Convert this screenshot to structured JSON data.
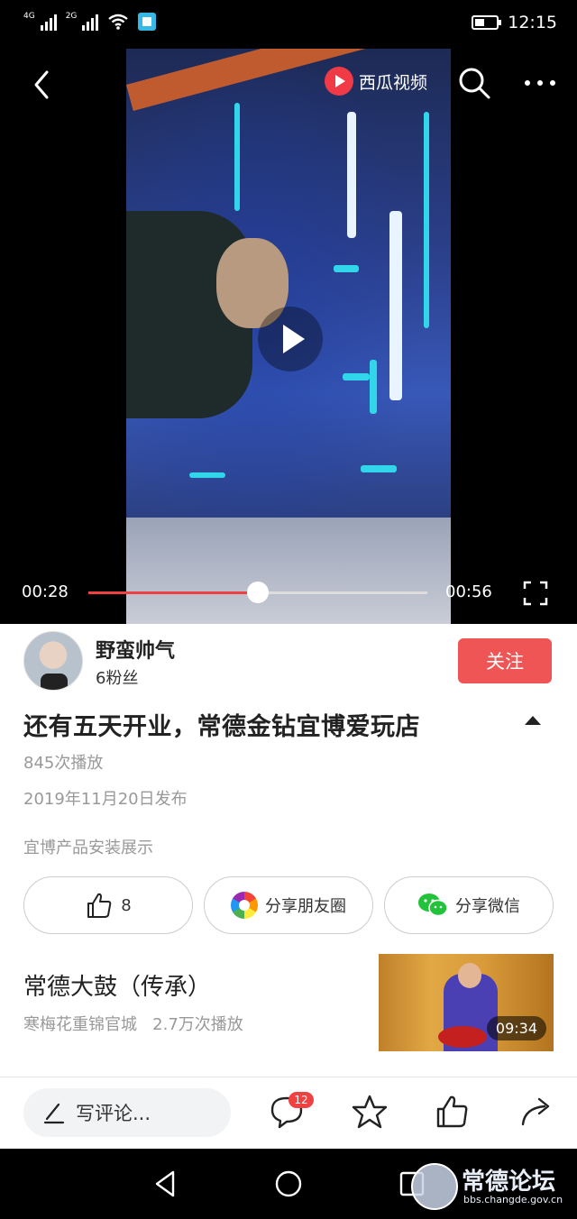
{
  "status_bar": {
    "network1": "4G",
    "network2": "2G",
    "time": "12:15"
  },
  "player": {
    "brand": "西瓜视频",
    "current_time": "00:28",
    "total_time": "00:56",
    "progress": 0.5,
    "state": "paused"
  },
  "author": {
    "name": "野蛮帅气",
    "fans": "6粉丝",
    "follow_label": "关注"
  },
  "video": {
    "title": "还有五天开业，常德金钻宜博爱玩店",
    "plays": "845次播放",
    "published": "2019年11月20日发布",
    "description": "宜博产品安装展示"
  },
  "actions": {
    "like_count": "8",
    "share_moments": "分享朋友圈",
    "share_wechat": "分享微信"
  },
  "recommended": {
    "title": "常德大鼓（传承）",
    "source": "寒梅花重锦官城",
    "plays": "2.7万次播放",
    "duration": "09:34"
  },
  "comment_bar": {
    "placeholder": "写评论...",
    "comment_count": "12"
  },
  "watermark": {
    "name": "常德论坛",
    "url": "bbs.changde.gov.cn"
  },
  "colors": {
    "accent": "#f05555",
    "progress": "#f04142",
    "brand": "#f03a45"
  }
}
